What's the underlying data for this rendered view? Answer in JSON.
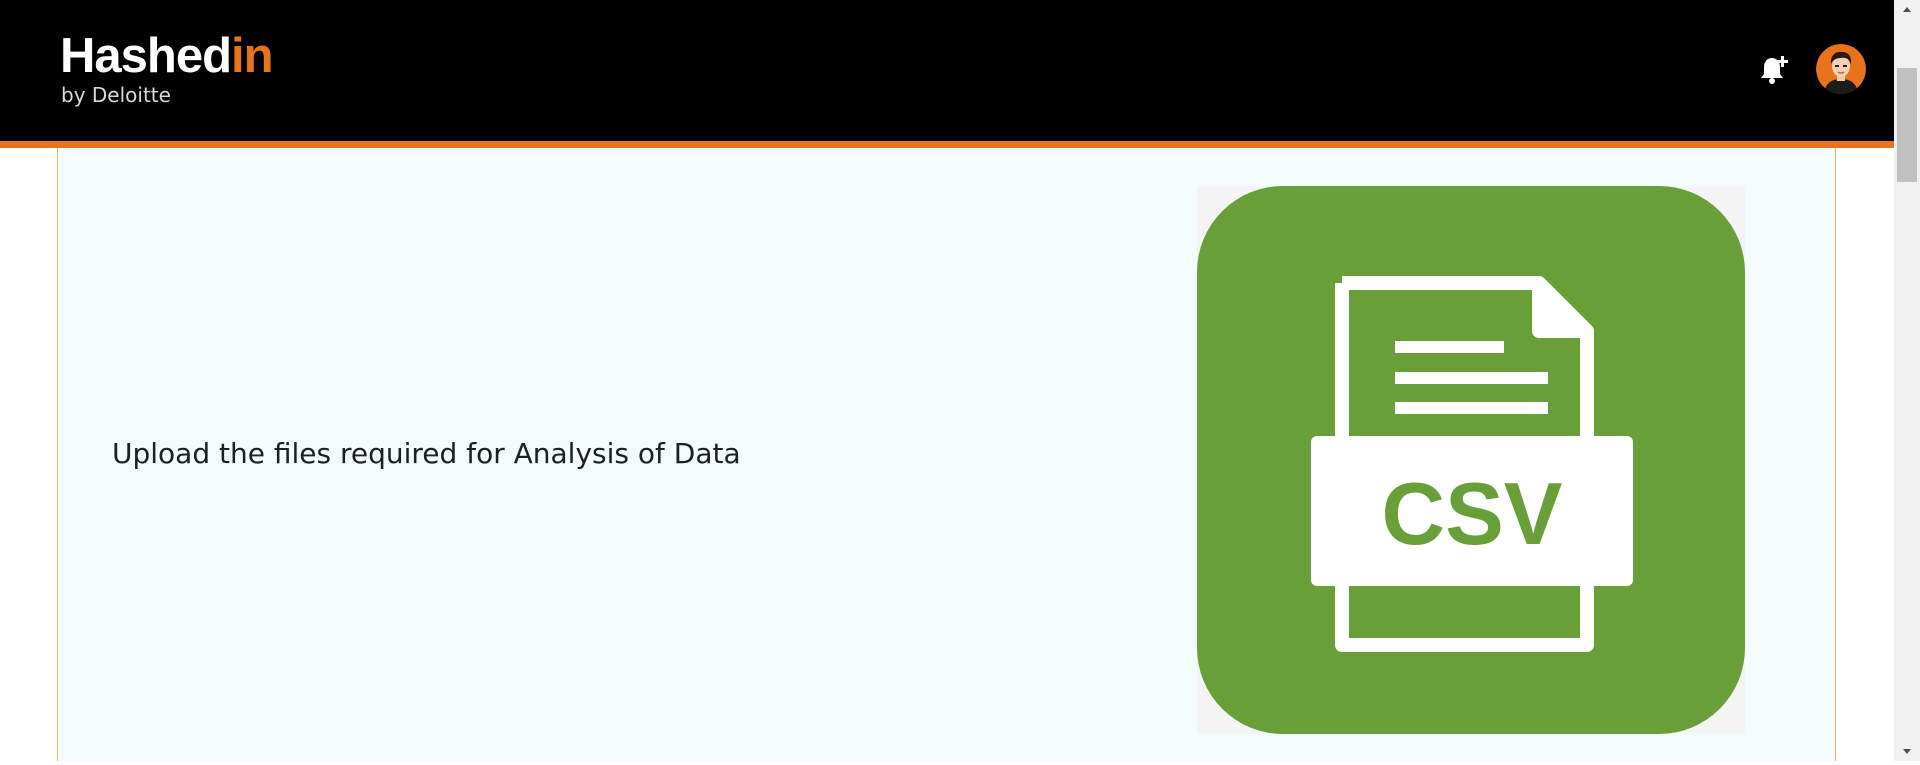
{
  "header": {
    "logo": {
      "word_main": "Hashed",
      "word_accent": "in",
      "tagline": "by Deloitte"
    },
    "notification_icon": "bell-plus-icon",
    "avatar_icon": "user-avatar-icon"
  },
  "main": {
    "upload_message": "Upload the files required for Analysis of Data",
    "csv_image": {
      "label": "CSV",
      "icon": "csv-file-icon"
    }
  },
  "colors": {
    "header_bg": "#000000",
    "brand_orange": "#e8731b",
    "card_bg": "#f3fbfc",
    "card_border": "#f0b259",
    "csv_green": "#689f38"
  }
}
